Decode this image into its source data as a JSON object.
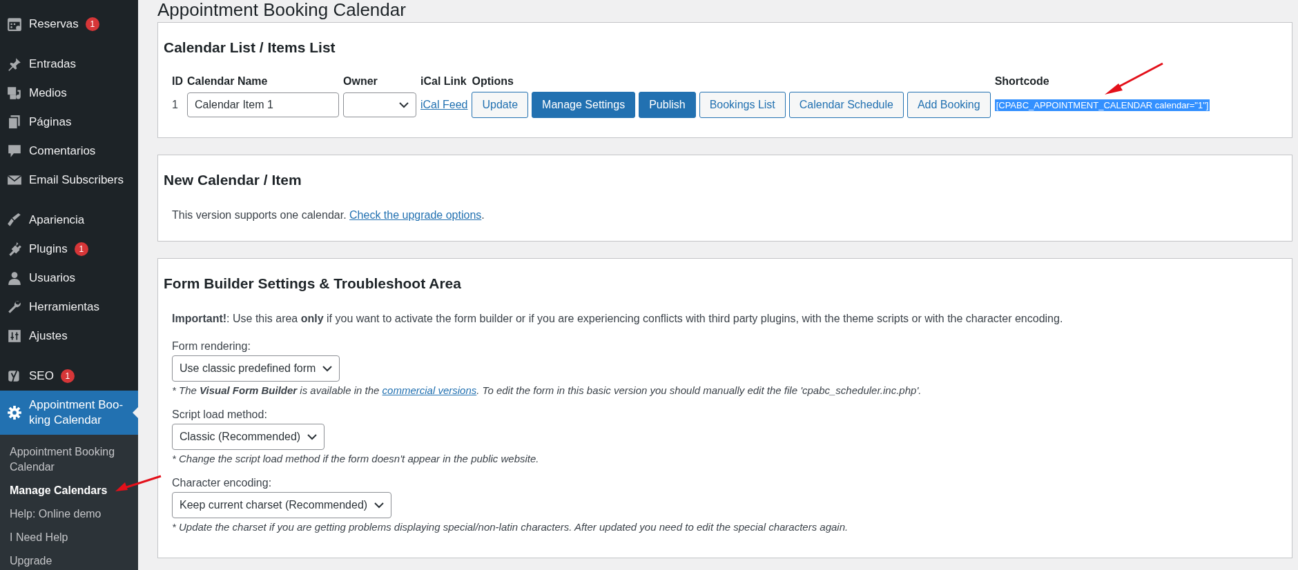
{
  "sidebar": {
    "items": [
      {
        "label": "Reservas",
        "badge": "1",
        "current": false
      },
      {
        "label": "Entradas",
        "current": false
      },
      {
        "label": "Medios",
        "current": false
      },
      {
        "label": "Páginas",
        "current": false
      },
      {
        "label": "Comentarios",
        "current": false
      },
      {
        "label": "Email Subscribers",
        "current": false
      },
      {
        "label": "Apariencia",
        "current": false
      },
      {
        "label": "Plugins",
        "badge": "1",
        "current": false
      },
      {
        "label": "Usuarios",
        "current": false
      },
      {
        "label": "Herramientas",
        "current": false
      },
      {
        "label": "Ajustes",
        "current": false
      },
      {
        "label": "SEO",
        "badge": "1",
        "current": false
      },
      {
        "label": "Appointment Boo-king Calendar",
        "current": true
      }
    ],
    "submenu": [
      {
        "label": "Appointment Booking Calendar",
        "selected": false
      },
      {
        "label": "Manage Calendars",
        "selected": true
      },
      {
        "label": "Help: Online demo",
        "selected": false
      },
      {
        "label": "I Need Help",
        "selected": false
      },
      {
        "label": "Upgrade",
        "selected": false
      }
    ]
  },
  "page_title": "Appointment Booking Calendar",
  "calendar_list": {
    "title": "Calendar List / Items List",
    "columns": [
      "ID",
      "Calendar Name",
      "Owner",
      "iCal Link",
      "Options",
      "Shortcode"
    ],
    "row": {
      "id": "1",
      "name": "Calendar Item 1",
      "ical_link": "iCal Feed",
      "buttons": [
        {
          "label": "Update",
          "primary": false
        },
        {
          "label": "Manage Settings",
          "primary": true
        },
        {
          "label": "Publish",
          "primary": true
        },
        {
          "label": "Bookings List",
          "primary": false
        },
        {
          "label": "Calendar Schedule",
          "primary": false
        },
        {
          "label": "Add Booking",
          "primary": false
        }
      ],
      "shortcode": "[CPABC_APPOINTMENT_CALENDAR calendar=\"1\"]"
    }
  },
  "new_calendar": {
    "title": "New Calendar / Item",
    "text": "This version supports one calendar.",
    "link": "Check the upgrade options",
    "after": "."
  },
  "form_builder": {
    "title": "Form Builder Settings & Troubleshoot Area",
    "intro": "**Important!**: Use this area **only** if you want to activate the form builder or if you are experiencing conflicts with third party plugins, with the theme scripts or with the character encoding.",
    "settings": [
      {
        "label": "Form rendering:",
        "value": "Use classic predefined form",
        "note_before": "* The **Visual Form Builder** is available in the ",
        "note_link": "commercial versions",
        "note_after": ". To edit the form in this basic version you should manually edit the file 'cpabc_scheduler.inc.php'."
      },
      {
        "label": "Script load method:",
        "value": "Classic (Recommended)",
        "note_before": "* Change the script load method if the form doesn't appear in the public website."
      },
      {
        "label": "Character encoding:",
        "value": "Keep current charset (Recommended)",
        "note_before": "* Update the charset if you are getting problems displaying special/non-latin characters. After updated you need to edit the special characters again."
      }
    ]
  }
}
